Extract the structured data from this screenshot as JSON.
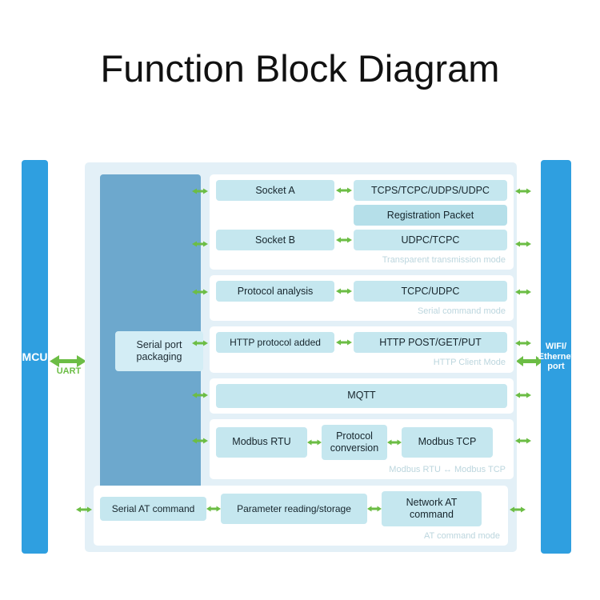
{
  "title": "Function Block Diagram",
  "colors": {
    "port_bar": "#2f9fe0",
    "serial_column": "#6da8cd",
    "cell": "#c5e7ef",
    "serial_box": "#d3edf5",
    "container": "#e3f0f7",
    "group": "#ffffff",
    "arrow": "#6cbd45",
    "mode_label": "#bcd6de"
  },
  "left_port": {
    "label": "MCU"
  },
  "right_port": {
    "line1": "WIFI/",
    "line2": "Ethernet",
    "line3": "port"
  },
  "uart": {
    "label": "UART"
  },
  "serial_column": {
    "box_line1": "Serial port",
    "box_line2": "packaging"
  },
  "groups": [
    {
      "name": "transparent-transmission",
      "mode_label": "Transparent transmission mode",
      "rows": [
        {
          "left": "Socket A",
          "right": "TCPS/TCPC/UDPS/UDPC"
        },
        {
          "left": "",
          "right": "Registration Packet"
        },
        {
          "left": "Socket B",
          "right": "UDPC/TCPC"
        }
      ]
    },
    {
      "name": "serial-command",
      "mode_label": "Serial command mode",
      "rows": [
        {
          "left": "Protocol analysis",
          "right": "TCPC/UDPC"
        }
      ]
    },
    {
      "name": "http-client",
      "mode_label": "HTTP Client Mode",
      "rows": [
        {
          "left": "HTTP protocol added",
          "right": "HTTP POST/GET/PUT"
        }
      ]
    },
    {
      "name": "mqtt",
      "mode_label": "",
      "rows": [
        {
          "left": "",
          "right": "MQTT"
        }
      ]
    },
    {
      "name": "modbus",
      "mode_label": "Modbus RTU ↔ Modbus TCP",
      "rows": [
        {
          "left": "Modbus RTU",
          "middle": "Protocol conversion",
          "right": "Modbus TCP"
        }
      ]
    }
  ],
  "at_group": {
    "mode_label": "AT command mode",
    "left": "Serial AT command",
    "middle": "Parameter reading/storage",
    "right": "Network AT command"
  }
}
